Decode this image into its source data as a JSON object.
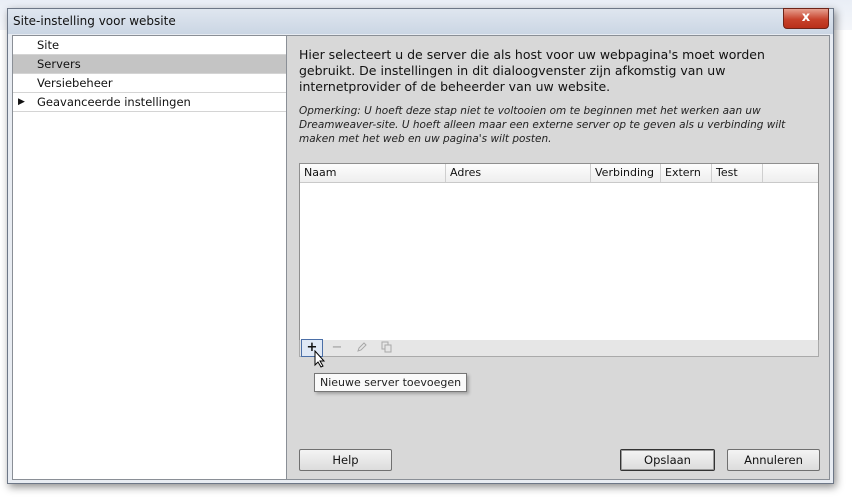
{
  "window": {
    "title": "Site-instelling voor website",
    "close_glyph": "x"
  },
  "sidebar": {
    "items": [
      {
        "label": "Site",
        "selected": false,
        "expandable": false
      },
      {
        "label": "Servers",
        "selected": true,
        "expandable": false
      },
      {
        "label": "Versiebeheer",
        "selected": false,
        "expandable": false
      },
      {
        "label": "Geavanceerde instellingen",
        "selected": false,
        "expandable": true
      }
    ]
  },
  "main": {
    "description": "Hier selecteert u de server die als host voor uw webpagina's moet worden gebruikt. De instellingen in dit dialoogvenster zijn afkomstig van uw internetprovider of de beheerder van uw website.",
    "note": "Opmerking: U hoeft deze stap niet te voltooien om te beginnen met het werken aan uw Dreamweaver-site. U hoeft alleen maar een externe server op te geven als u verbinding wilt maken met het web en uw pagina's wilt posten.",
    "table": {
      "columns": [
        "Naam",
        "Adres",
        "Verbinding",
        "Extern",
        "Test"
      ],
      "rows": []
    },
    "toolbar": {
      "add": "plus-icon",
      "remove": "minus-icon",
      "edit": "pencil-icon",
      "duplicate": "duplicate-icon"
    },
    "tooltip": "Nieuwe server toevoegen"
  },
  "buttons": {
    "help": "Help",
    "save": "Opslaan",
    "cancel": "Annuleren"
  }
}
